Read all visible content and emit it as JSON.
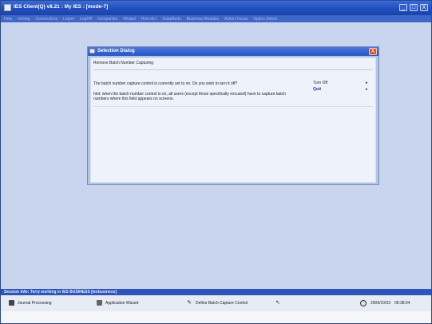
{
  "window": {
    "title": "IES Client(Q) v8.21 : My IES :     [mode-7]",
    "minimize": "_",
    "maximize": "□",
    "close": "X"
  },
  "menu": [
    "Help",
    "Infolog",
    "Connections",
    "Logon",
    "LogOff",
    "Companies",
    "Wizard",
    "How do I",
    "DataMarts",
    "Business Modules",
    "Action Focus",
    "Option Select"
  ],
  "dialog": {
    "title": "Selection Dialog",
    "close": "X",
    "subtitle": "Remove Batch Number Capturing",
    "message": "The batch number capture control is currently set to on. Do you wish to turn it off?",
    "hint": "hint: when the batch number control is on, all users (except those specifically excused) have to capture batch numbers where this field appears on screens.",
    "options": [
      {
        "label": "Turn Off",
        "arrow": "▸"
      },
      {
        "label": "Quit",
        "arrow": "▸"
      }
    ]
  },
  "session": "Session Info: Terry working in IES BUSINESS   [iesbusiness]",
  "taskbar": {
    "items": [
      {
        "label": "Journal Processing",
        "icon": "journal-icon"
      },
      {
        "label": "Application Wizard",
        "icon": "wizard-hat-icon"
      },
      {
        "label": "Define Batch Capture Control",
        "icon": "wand-icon"
      },
      {
        "label": "",
        "icon": "cursor-icon"
      }
    ],
    "date": "2009/10/23",
    "time": "09:38:04"
  }
}
